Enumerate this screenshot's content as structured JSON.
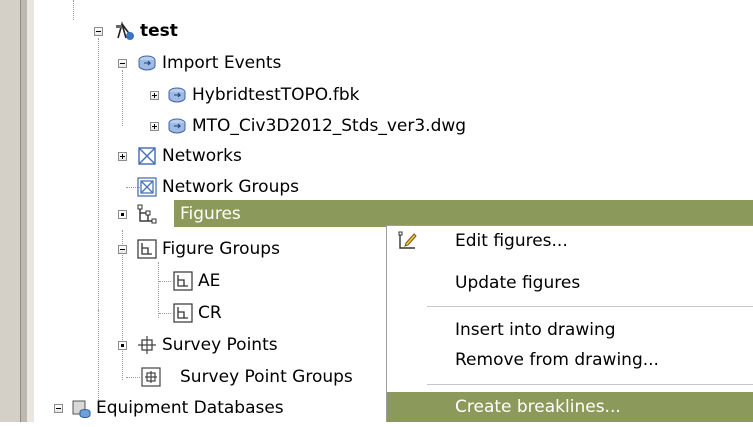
{
  "tree": {
    "project": "test",
    "import_events": "Import Events",
    "import_items": [
      "HybridtestTOPO.fbk",
      "MTO_Civ3D2012_Stds_ver3.dwg"
    ],
    "networks": "Networks",
    "network_groups": "Network Groups",
    "figures": "Figures",
    "figure_groups": "Figure Groups",
    "figure_group_items": [
      "AE",
      "CR"
    ],
    "survey_points": "Survey Points",
    "survey_point_groups": "Survey Point Groups",
    "equipment_databases": "Equipment Databases"
  },
  "context_menu": {
    "items": [
      "Edit figures...",
      "Update figures",
      "Insert into drawing",
      "Remove from drawing...",
      "Create breaklines..."
    ],
    "highlighted": "Create breaklines..."
  },
  "colors": {
    "selection": "#8b9a5a",
    "background": "#ffffff"
  }
}
